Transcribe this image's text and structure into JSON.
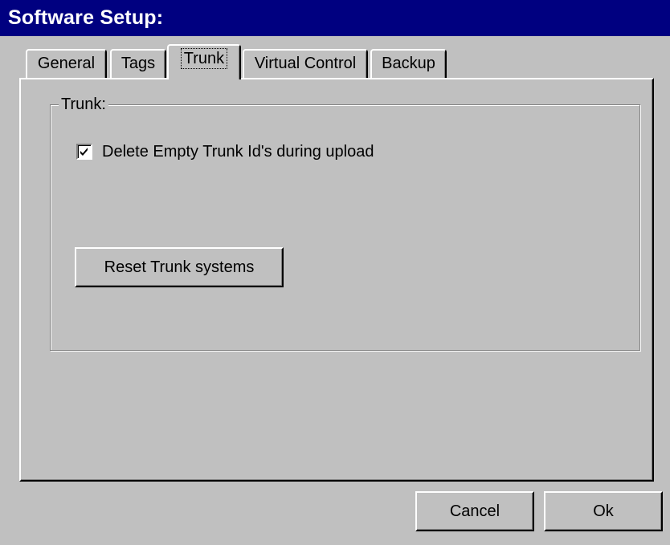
{
  "window": {
    "title": "Software Setup:"
  },
  "tabs": [
    {
      "label": "General",
      "active": false
    },
    {
      "label": "Tags",
      "active": false
    },
    {
      "label": "Trunk",
      "active": true
    },
    {
      "label": "Virtual Control",
      "active": false
    },
    {
      "label": "Backup",
      "active": false
    }
  ],
  "trunk_panel": {
    "group_title": "Trunk:",
    "delete_empty_checkbox": {
      "label": "Delete Empty Trunk Id's during upload",
      "checked": true
    },
    "reset_button_label": "Reset Trunk systems"
  },
  "footer": {
    "cancel_label": "Cancel",
    "ok_label": "Ok"
  },
  "colors": {
    "face": "#c0c0c0",
    "titlebar": "#000080",
    "titlebar_text": "#ffffff"
  },
  "icons": {
    "checkbox_mark": "check-icon"
  }
}
